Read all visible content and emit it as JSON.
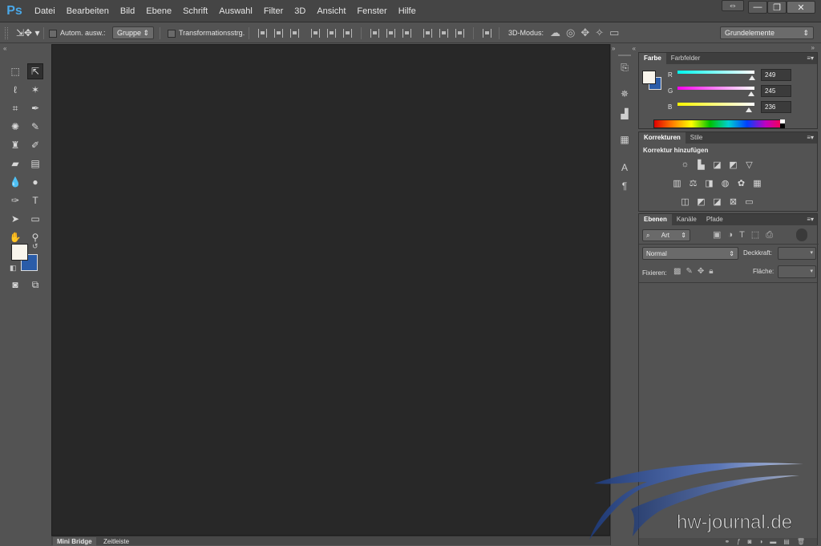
{
  "app": {
    "logo": "Ps"
  },
  "menu": [
    "Datei",
    "Bearbeiten",
    "Bild",
    "Ebene",
    "Schrift",
    "Auswahl",
    "Filter",
    "3D",
    "Ansicht",
    "Fenster",
    "Hilfe"
  ],
  "window_controls": {
    "minimize": "—",
    "restore": "❐",
    "close": "✕"
  },
  "options": {
    "auto_select_label": "Autom. ausw.:",
    "auto_select_value": "Gruppe",
    "transform_label": "Transformationsstrg.",
    "mode3d_label": "3D-Modus:",
    "workspace": "Grundelemente"
  },
  "panels": {
    "color": {
      "tabs": [
        "Farbe",
        "Farbfelder"
      ],
      "channels": [
        {
          "label": "R",
          "value": "249"
        },
        {
          "label": "G",
          "value": "245"
        },
        {
          "label": "B",
          "value": "236"
        }
      ],
      "foreground": "#f9f5ec",
      "background": "#2a5ca8"
    },
    "adjustments": {
      "tabs": [
        "Korrekturen",
        "Stile"
      ],
      "heading": "Korrektur hinzufügen"
    },
    "layers": {
      "tabs": [
        "Ebenen",
        "Kanäle",
        "Pfade"
      ],
      "filter_kind": "Art",
      "blend_mode": "Normal",
      "opacity_label": "Deckkraft:",
      "lock_label": "Fixieren:",
      "fill_label": "Fläche:"
    }
  },
  "bottom_tabs": [
    "Mini Bridge",
    "Zeitleiste"
  ],
  "watermark": "hw-journal.de",
  "colors": {
    "accent": "#4aa8e8",
    "canvas": "#282828",
    "chrome": "#535353"
  }
}
